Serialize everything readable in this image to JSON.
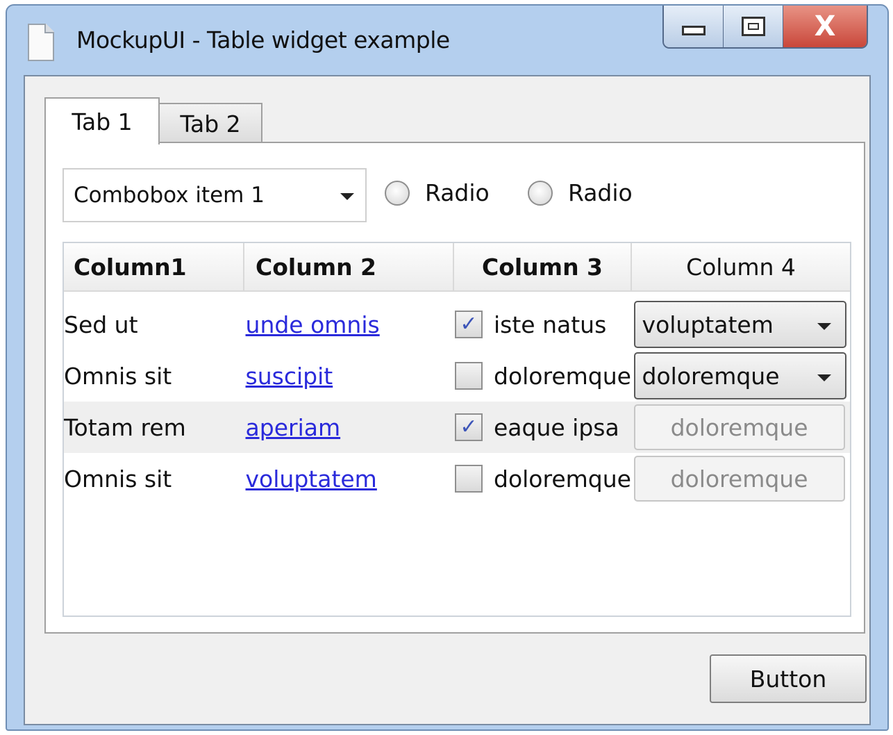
{
  "window": {
    "title": "MockupUI - Table widget example",
    "controls": {
      "minimize": "minimize",
      "maximize": "maximize",
      "close": "X"
    }
  },
  "tabs": [
    {
      "label": "Tab 1",
      "active": true
    },
    {
      "label": "Tab 2",
      "active": false
    }
  ],
  "combobox": {
    "value": "Combobox item 1"
  },
  "radios": [
    {
      "label": "Radio",
      "checked": false
    },
    {
      "label": "Radio",
      "checked": false
    }
  ],
  "table": {
    "columns": [
      "Column1",
      "Column 2",
      "Column 3",
      "Column 4"
    ],
    "rows": [
      {
        "col1": "Sed ut",
        "col2": "unde omnis",
        "col3_checked": true,
        "col3": "iste natus",
        "col4": "voluptatem",
        "col4_enabled": true
      },
      {
        "col1": "Omnis sit",
        "col2": "suscipit",
        "col3_checked": false,
        "col3": "doloremque",
        "col4": "doloremque",
        "col4_enabled": true
      },
      {
        "col1": "Totam rem",
        "col2": "aperiam",
        "col3_checked": true,
        "col3": "eaque ipsa",
        "col4": "doloremque",
        "col4_enabled": false
      },
      {
        "col1": "Omnis sit",
        "col2": "voluptatem",
        "col3_checked": false,
        "col3": "doloremque",
        "col4": "doloremque",
        "col4_enabled": false
      }
    ]
  },
  "button": {
    "label": "Button"
  },
  "colors": {
    "titlebar": "#b4cfee",
    "close": "#c9473a",
    "link": "#2a2adb",
    "check": "#3c54b8"
  }
}
